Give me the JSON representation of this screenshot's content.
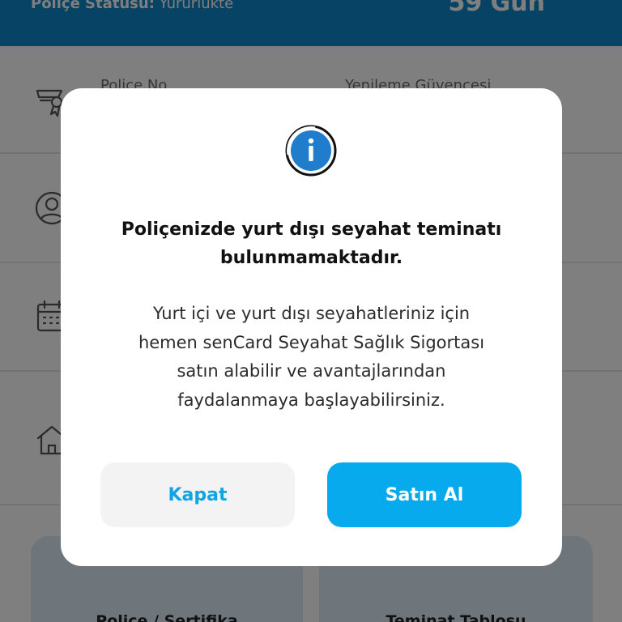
{
  "header": {
    "status_label": "Poliçe Statüsü:",
    "status_value": "Yürürlükte",
    "days": "59 Gün"
  },
  "policy_rows": {
    "policy_no_label": "Poliçe No",
    "renewal_label": "Yenileme Güvencesi"
  },
  "cards": [
    {
      "title": "Poliçe / Sertifika"
    },
    {
      "title": "Teminat Tablosu"
    }
  ],
  "icons": {
    "row1": "certificate-icon",
    "row2": "user-circle-icon",
    "row3": "calendar-icon",
    "row4": "home-icon",
    "modal": "info-icon"
  },
  "colors": {
    "header_bg": "#0d86c9",
    "accent": "#08aaee",
    "info_icon": "#1f7dcb",
    "close_button_bg": "#f3f3f3"
  },
  "modal": {
    "title_lines": [
      "Poliçenizde yurt dışı seyahat teminatı",
      "bulunmamaktadır."
    ],
    "body_lines": [
      "Yurt içi ve yurt dışı seyahatleriniz için",
      "hemen senCard Seyahat Sağlık Sigortası",
      "satın alabilir ve avantajlarından",
      "faydalanmaya başlayabilirsiniz."
    ],
    "close_label": "Kapat",
    "buy_label": "Satın Al"
  }
}
